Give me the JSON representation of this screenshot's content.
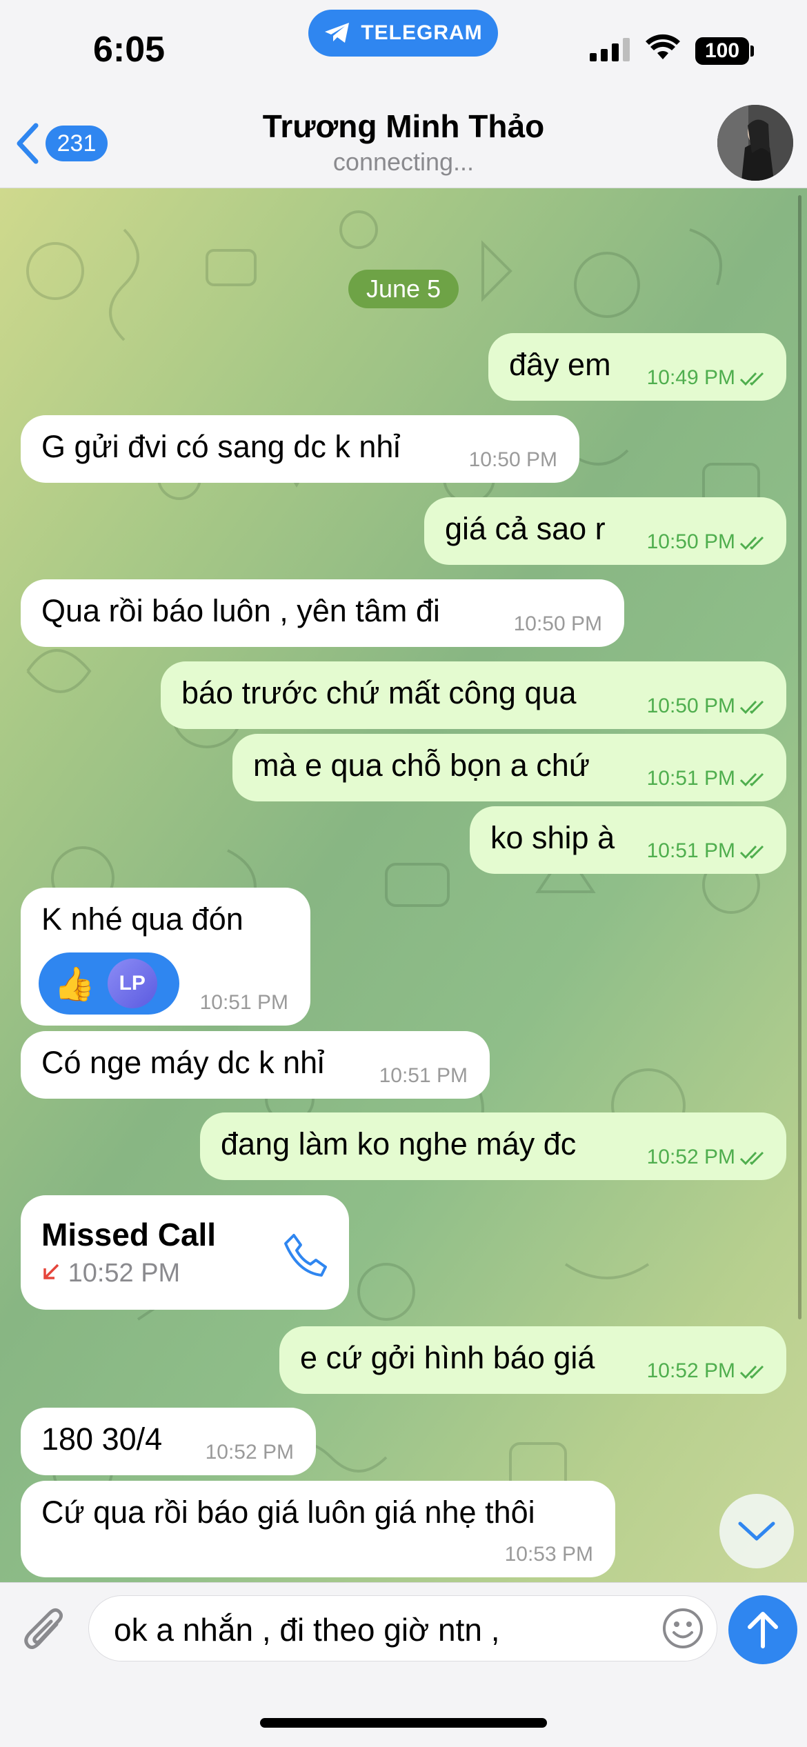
{
  "status_bar": {
    "time": "6:05",
    "app_pill": "TELEGRAM",
    "battery": "100"
  },
  "header": {
    "back_count": "231",
    "title": "Trương Minh Thảo",
    "subtitle": "connecting..."
  },
  "chat": {
    "date": "June 5",
    "messages": [
      {
        "dir": "out",
        "text": "đây em",
        "time": "10:49 PM"
      },
      {
        "dir": "in",
        "text": "G gửi đvi có sang dc k nhỉ",
        "time": "10:50 PM"
      },
      {
        "dir": "out",
        "text": "giá cả sao r",
        "time": "10:50 PM"
      },
      {
        "dir": "in",
        "text": "Qua rồi báo luôn , yên tâm đi",
        "time": "10:50 PM"
      },
      {
        "dir": "out",
        "text": "báo trước chứ mất công qua",
        "time": "10:50 PM"
      },
      {
        "dir": "out",
        "text": "mà e qua chỗ bọn a chứ",
        "time": "10:51 PM"
      },
      {
        "dir": "out",
        "text": "ko ship à",
        "time": "10:51 PM"
      },
      {
        "dir": "in",
        "text": "K nhé qua đón",
        "time": "10:51 PM",
        "reaction": {
          "emoji": "👍",
          "initials": "LP"
        }
      },
      {
        "dir": "in",
        "text": "Có nge máy dc k nhỉ",
        "time": "10:51 PM"
      },
      {
        "dir": "out",
        "text": "đang làm ko nghe máy đc",
        "time": "10:52 PM"
      },
      {
        "dir": "in",
        "type": "call",
        "text": "Missed Call",
        "time": "10:52 PM"
      },
      {
        "dir": "out",
        "text": "e cứ gởi hình báo giá",
        "time": "10:52 PM"
      },
      {
        "dir": "in",
        "text": "180 30/4",
        "time": "10:52 PM"
      },
      {
        "dir": "in",
        "text": "Cứ qua rồi báo giá luôn giá nhẹ thôi",
        "time": "10:53 PM"
      }
    ]
  },
  "composer": {
    "value": "ok a nhắn , đi theo giờ ntn ,"
  },
  "icons": {
    "back": "chevron-left-icon",
    "attach": "paperclip-icon",
    "emoji": "smiley-icon",
    "send": "arrow-up-icon",
    "scroll_down": "chevron-down-icon",
    "call": "phone-icon",
    "missed": "missed-call-arrow-icon"
  },
  "colors": {
    "accent": "#2f86f0",
    "outgoing_bubble": "#e4fbd0",
    "outgoing_meta": "#4fae4e",
    "date_pill": "#6ea346",
    "missed_red": "#e5453b"
  }
}
